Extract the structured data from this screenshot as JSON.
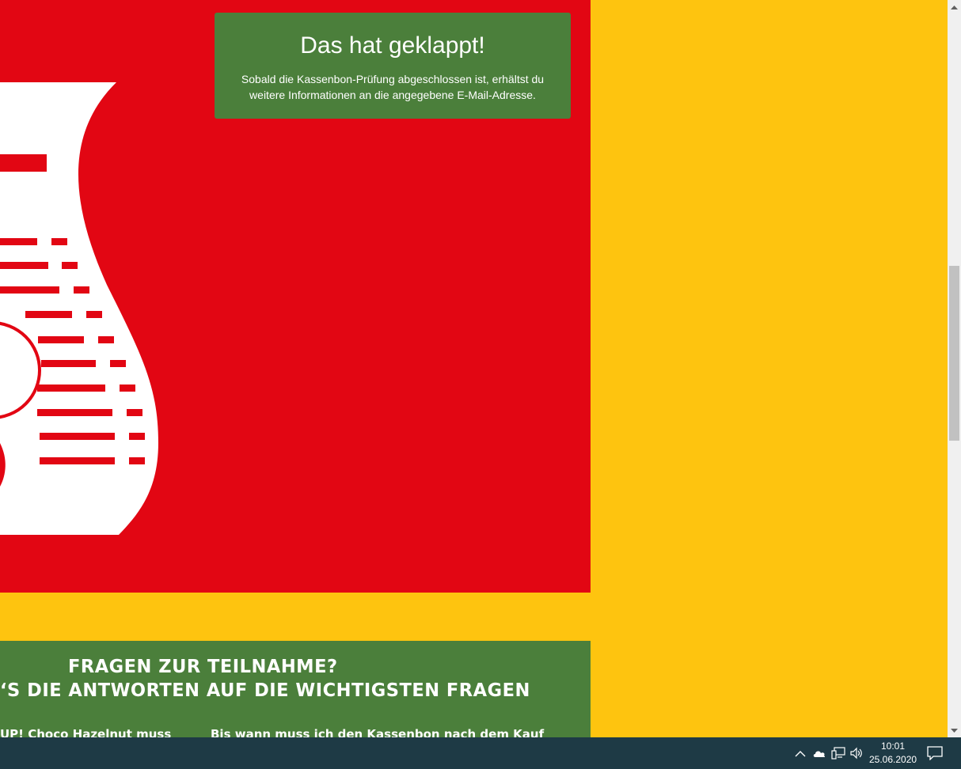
{
  "success": {
    "title": "Das hat geklappt!",
    "text": "Sobald die Kassenbon-Prüfung abgeschlossen ist, erhältst du weitere Informationen an die angegebene E-Mail-Adresse."
  },
  "faq": {
    "heading_line1": "FRAGEN ZUR TEILNAHME?",
    "heading_line2": "‘S DIE ANTWORTEN AUF DIE WICHTIGSTEN FRAGEN",
    "question_1": "UP! Choco Hazelnut muss",
    "question_2": "Bis wann muss ich den Kassenbon nach dem Kauf"
  },
  "taskbar": {
    "time": "10:01",
    "date": "25.06.2020"
  },
  "colors": {
    "page_background": "#FEC40F",
    "red_panel": "#E20613",
    "green_panel": "#4B7F3B",
    "taskbar": "#1E3A45"
  },
  "icons": {
    "tray": [
      "chevron-up-icon",
      "cloud-icon",
      "network-icon",
      "volume-icon"
    ],
    "notification": "notification-icon"
  }
}
